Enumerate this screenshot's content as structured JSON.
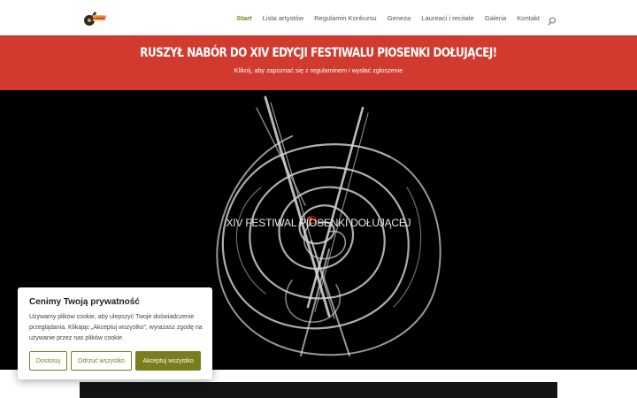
{
  "header": {
    "logo_alt": "Festiwal Piosenki Dołującej logo",
    "nav": [
      {
        "label": "Start",
        "active": true
      },
      {
        "label": "Lista artystów",
        "active": false
      },
      {
        "label": "Regulamin Konkursu",
        "active": false
      },
      {
        "label": "Geneza",
        "active": false
      },
      {
        "label": "Laureaci i recitale",
        "active": false
      },
      {
        "label": "Galeria",
        "active": false
      },
      {
        "label": "Kontakt",
        "active": false
      }
    ],
    "search_icon": "search-icon"
  },
  "banner": {
    "title": "RUSZYŁ NABÓR DO XIV EDYCJI FESTIWALU PIOSENKI DOŁUJĄCEJ!",
    "subtitle": "Kliknij, aby zapoznać się z regulaminem i wysłać zgłoszenie",
    "color": "#d13a2f"
  },
  "hero": {
    "title_prefix": "XIV FESTIWAL PI",
    "title_o": "O",
    "title_suffix": "SENKI DOŁUJĄCEJ",
    "accent": "#e0261b"
  },
  "cookie": {
    "title": "Cenimy Twoją prywatność",
    "text": "Używamy plików cookie, aby ulepszyć Twoje doświadczenie przeglądania. Klikając „Akceptuj wszystko”, wyrażasz zgodę na używanie przez nas plików cookie.",
    "btn_customize": "Dostosuj",
    "btn_reject": "Odrzuć wszystko",
    "btn_accept": "Akceptuj wszystko",
    "accent": "#7a7d1e"
  }
}
